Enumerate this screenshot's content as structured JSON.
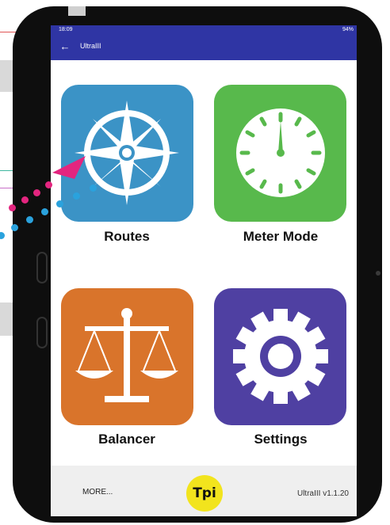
{
  "status_bar": {
    "time": "18:09",
    "battery": "94%"
  },
  "app_bar": {
    "back_icon": "arrow-left",
    "title": "UltraIII"
  },
  "tiles": [
    {
      "label": "Routes",
      "icon": "compass-icon",
      "color": "#3b93c6"
    },
    {
      "label": "Meter Mode",
      "icon": "gauge-icon",
      "color": "#58b94c"
    },
    {
      "label": "Balancer",
      "icon": "balance-scale-icon",
      "color": "#d9742b"
    },
    {
      "label": "Settings",
      "icon": "gear-icon",
      "color": "#4f40a2"
    }
  ],
  "footer": {
    "more": "MORE...",
    "logo_text": "Tpi",
    "version": "UltraIII v1.1.20"
  },
  "colors": {
    "app_bar": "#2f35a4",
    "pointer_pink": "#e3257f",
    "pointer_blue": "#2aa2dd"
  }
}
